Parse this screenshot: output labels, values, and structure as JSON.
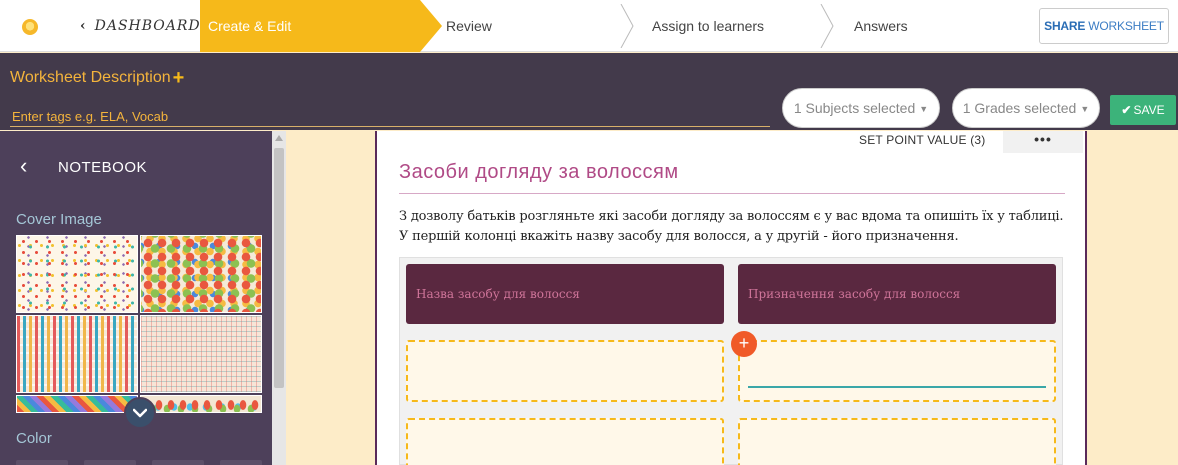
{
  "nav": {
    "dashboard_label": "Dashboard",
    "steps": [
      {
        "label": "Create & Edit",
        "active": true
      },
      {
        "label": "Review",
        "active": false
      },
      {
        "label": "Assign to learners",
        "active": false
      },
      {
        "label": "Answers",
        "active": false
      }
    ],
    "share_bold": "SHARE",
    "share_rest": " WORKSHEET"
  },
  "description": {
    "title": "Worksheet Description",
    "tags_placeholder": "Enter tags e.g. ELA, Vocab",
    "subjects": "1 Subjects selected",
    "grades": "1 Grades selected",
    "save_label": "SAVE"
  },
  "sidebar": {
    "title": "NOTEBOOK",
    "cover_label": "Cover Image",
    "color_label": "Color"
  },
  "worksheet": {
    "point_value_label": "SET POINT VALUE (3)",
    "more_label": "•••",
    "title": "Засоби догляду за волоссям",
    "instructions": "З дозволу батьків розгляньте які засоби догляду за волоссям є у вас вдома та опишіть їх у таблиці. У першій колонці вкажіть назву засобу для волосся, а у другій - його призначення.",
    "columns": [
      "Назва засобу для волосся",
      "Призначення засобу для волосся"
    ],
    "add_symbol": "+"
  },
  "colors": {
    "accent_yellow": "#f6b91a",
    "header_purple": "#433a4b",
    "sidebar_purple": "#4d405a",
    "table_header": "#5a2840",
    "title_pink": "#b04a86",
    "save_green": "#3cb37a",
    "add_orange": "#f05a28"
  }
}
